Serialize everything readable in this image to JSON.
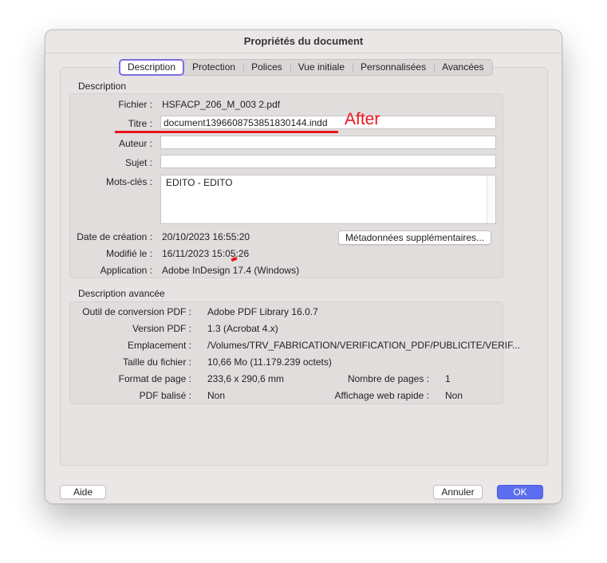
{
  "dialog": {
    "title": "Propriétés du document"
  },
  "tabs": [
    "Description",
    "Protection",
    "Polices",
    "Vue initiale",
    "Personnalisées",
    "Avancées"
  ],
  "description": {
    "section_title": "Description",
    "file_label": "Fichier :",
    "file_value": "HSFACP_206_M_003 2.pdf",
    "title_label": "Titre :",
    "title_value": "document1396608753851830144.indd",
    "author_label": "Auteur :",
    "author_value": "",
    "subject_label": "Sujet :",
    "subject_value": "",
    "keywords_label": "Mots-clés :",
    "keywords_value": "EDITO - EDITO",
    "created_label": "Date de création :",
    "created_value": "20/10/2023 16:55:20",
    "modified_label": "Modifié le :",
    "modified_value": "16/11/2023 15:05:26",
    "application_label": "Application :",
    "application_value": "Adobe InDesign 17.4 (Windows)",
    "metadata_button": "Métadonnées supplémentaires..."
  },
  "advanced": {
    "section_title": "Description avancée",
    "pdf_producer_label": "Outil de conversion PDF :",
    "pdf_producer_value": "Adobe PDF Library 16.0.7",
    "pdf_version_label": "Version PDF :",
    "pdf_version_value": "1.3 (Acrobat 4.x)",
    "location_label": "Emplacement :",
    "location_value": "/Volumes/TRV_FABRICATION/VERIFICATION_PDF/PUBLICITE/VERIF...",
    "file_size_label": "Taille du fichier :",
    "file_size_value": "10,66 Mo (11.179.239 octets)",
    "page_size_label": "Format de page :",
    "page_size_value": "233,6 x 290,6 mm",
    "page_count_label": "Nombre de pages :",
    "page_count_value": "1",
    "tagged_label": "PDF balisé :",
    "tagged_value": "Non",
    "fast_web_label": "Affichage web rapide :",
    "fast_web_value": "Non"
  },
  "buttons": {
    "help": "Aide",
    "cancel": "Annuler",
    "ok": "OK"
  },
  "annotation": {
    "text": "After",
    "color": "#e8141c"
  }
}
